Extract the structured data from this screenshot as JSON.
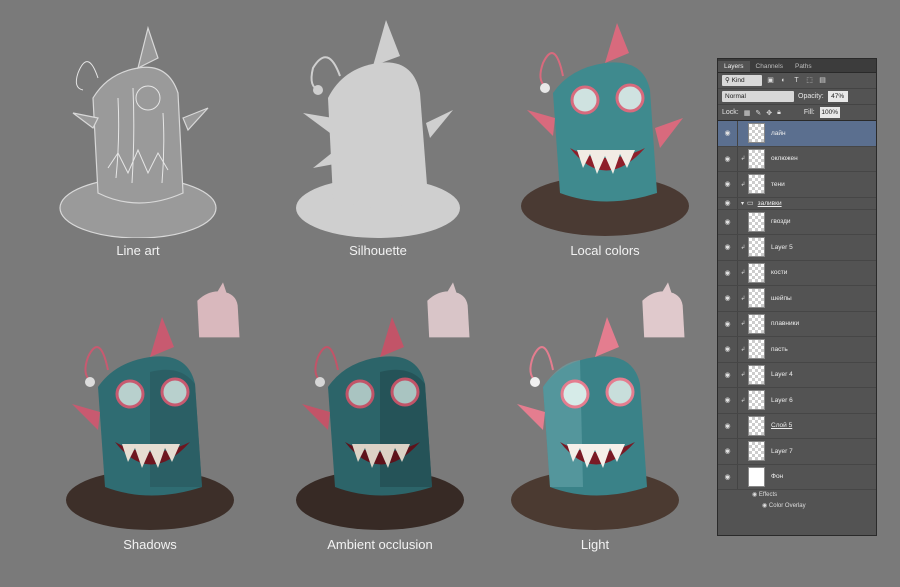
{
  "stages": [
    {
      "caption": "Line art"
    },
    {
      "caption": "Silhouette"
    },
    {
      "caption": "Local colors"
    },
    {
      "caption": "Shadows"
    },
    {
      "caption": "Ambient occlusion"
    },
    {
      "caption": "Light"
    }
  ],
  "colors": {
    "background": "#7a7a7a",
    "body_teal": "#3f8a8e",
    "mouth_red": "#8e1f2a",
    "fin_pink": "#d86a7d",
    "base_brown": "#4a3a33",
    "panel_bg": "#535353",
    "selected_row": "#5b6f8f"
  },
  "layers_panel": {
    "tabs": [
      "Layers",
      "Channels",
      "Paths"
    ],
    "filter_label": "Kind",
    "blend_mode": "Normal",
    "opacity_label": "Opacity:",
    "opacity_value": "47%",
    "lock_label": "Lock:",
    "fill_label": "Fill:",
    "fill_value": "100%",
    "layers": [
      {
        "name": "лайн",
        "selected": true
      },
      {
        "name": "оклюжен"
      },
      {
        "name": "тени"
      },
      {
        "name": "заливки",
        "group": true
      },
      {
        "name": "гвозди"
      },
      {
        "name": "Layer 5"
      },
      {
        "name": "кости"
      },
      {
        "name": "шейпы"
      },
      {
        "name": "плавники"
      },
      {
        "name": "пасть"
      },
      {
        "name": "Layer 4"
      },
      {
        "name": "Layer 6"
      },
      {
        "name": "Слой 5"
      },
      {
        "name": "Layer 7"
      },
      {
        "name": "Фон"
      }
    ],
    "effects_label": "Effects",
    "color_overlay_label": "Color Overlay"
  }
}
